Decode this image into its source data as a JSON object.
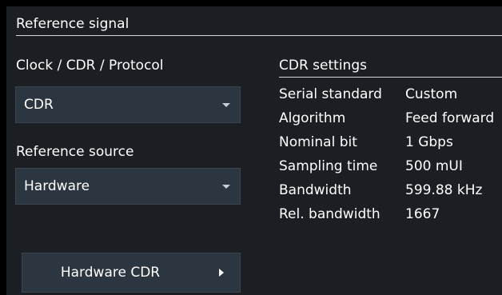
{
  "section": {
    "title": "Reference signal"
  },
  "clock_cdr_protocol": {
    "label": "Clock / CDR / Protocol",
    "selected": "CDR"
  },
  "reference_source": {
    "label": "Reference source",
    "selected": "Hardware"
  },
  "hardware_cdr_button": {
    "label": "Hardware CDR"
  },
  "cdr_settings": {
    "title": "CDR settings",
    "rows": [
      {
        "key": "Serial standard",
        "value": "Custom"
      },
      {
        "key": "Algorithm",
        "value": "Feed forward"
      },
      {
        "key": "Nominal bit",
        "value": "1 Gbps"
      },
      {
        "key": "Sampling time",
        "value": "500 mUI"
      },
      {
        "key": "Bandwidth",
        "value": "599.88 kHz"
      },
      {
        "key": "Rel. bandwidth",
        "value": "1667"
      }
    ]
  },
  "icons": {
    "dropdown_caret": "chevron-down-icon",
    "button_arrow": "triangle-right-icon"
  },
  "colors": {
    "background": "#000000",
    "panel": "#1b1e22",
    "control": "#2c3640",
    "rule": "#d8d8d8",
    "text": "#ffffff"
  }
}
